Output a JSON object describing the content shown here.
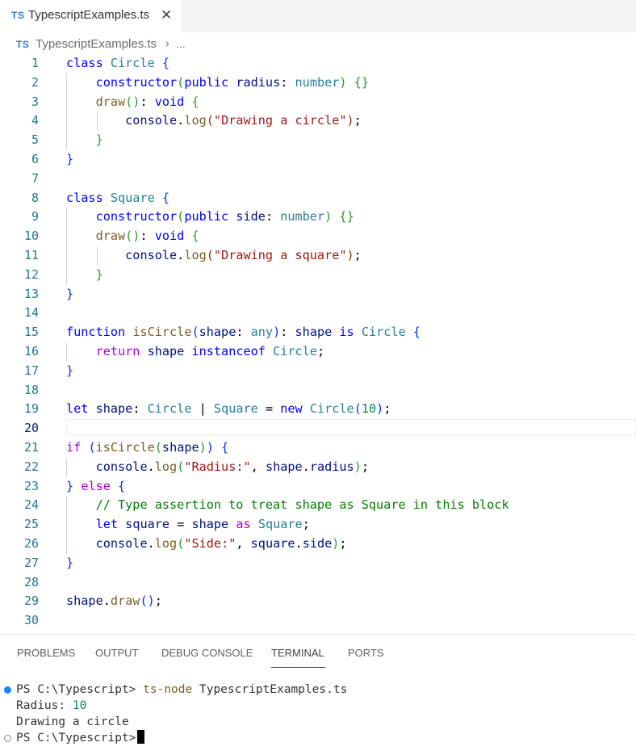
{
  "tab": {
    "badge": "TS",
    "label": "TypescriptExamples.ts",
    "close_glyph": "✕"
  },
  "breadcrumb": {
    "badge": "TS",
    "file": "TypescriptExamples.ts",
    "separator": "›",
    "rest": "..."
  },
  "editor": {
    "line_numbers": [
      "1",
      "2",
      "3",
      "4",
      "5",
      "6",
      "7",
      "8",
      "9",
      "10",
      "11",
      "12",
      "13",
      "14",
      "15",
      "16",
      "17",
      "18",
      "19",
      "20",
      "21",
      "22",
      "23",
      "24",
      "25",
      "26",
      "27",
      "28",
      "29",
      "30"
    ],
    "active_line": "20"
  },
  "panel": {
    "tabs": [
      "PROBLEMS",
      "OUTPUT",
      "DEBUG CONSOLE",
      "TERMINAL",
      "PORTS"
    ],
    "active_tab": "TERMINAL"
  },
  "terminal": {
    "prompt": "PS C:\\Typescript>",
    "command": "ts-node",
    "command_arg": "TypescriptExamples.ts",
    "output_label": "Radius:",
    "output_value": "10",
    "output_line2": "Drawing a circle"
  },
  "colors": {
    "ts_badge": "#3178c6",
    "keyword": "#0000ff",
    "type": "#267f99",
    "string": "#a31515",
    "comment": "#008000",
    "status_dot": "#1a85ff"
  }
}
